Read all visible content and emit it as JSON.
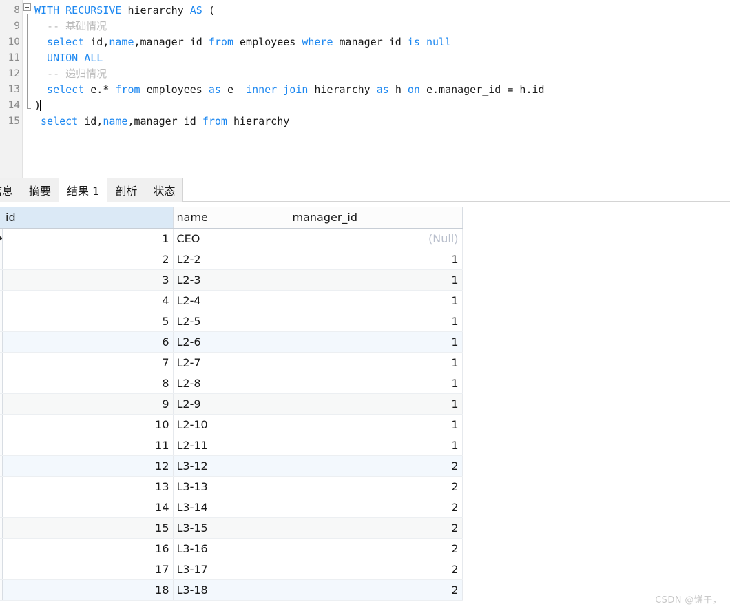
{
  "editor": {
    "first_line_number": 8,
    "fold_marker": "collapse-box",
    "lines": [
      {
        "number": "8",
        "tokens": [
          {
            "t": "WITH RECURSIVE ",
            "c": "kw"
          },
          {
            "t": "hierarchy ",
            "c": "plain"
          },
          {
            "t": "AS ",
            "c": "kw"
          },
          {
            "t": "(",
            "c": "plain"
          }
        ]
      },
      {
        "number": "9",
        "tokens": [
          {
            "t": "  -- 基础情况",
            "c": "cmt"
          }
        ]
      },
      {
        "number": "10",
        "tokens": [
          {
            "t": "  select ",
            "c": "kw"
          },
          {
            "t": "id,",
            "c": "plain"
          },
          {
            "t": "name",
            "c": "kw"
          },
          {
            "t": ",manager_id ",
            "c": "plain"
          },
          {
            "t": "from ",
            "c": "kw"
          },
          {
            "t": "employees ",
            "c": "plain"
          },
          {
            "t": "where ",
            "c": "kw"
          },
          {
            "t": "manager_id ",
            "c": "plain"
          },
          {
            "t": "is null",
            "c": "kw"
          }
        ]
      },
      {
        "number": "11",
        "tokens": [
          {
            "t": "  UNION ALL",
            "c": "kw"
          }
        ]
      },
      {
        "number": "12",
        "tokens": [
          {
            "t": "  -- 递归情况",
            "c": "cmt"
          }
        ]
      },
      {
        "number": "13",
        "tokens": [
          {
            "t": "  select ",
            "c": "kw"
          },
          {
            "t": "e.* ",
            "c": "plain"
          },
          {
            "t": "from ",
            "c": "kw"
          },
          {
            "t": "employees ",
            "c": "plain"
          },
          {
            "t": "as ",
            "c": "kw"
          },
          {
            "t": "e  ",
            "c": "plain"
          },
          {
            "t": "inner join ",
            "c": "kw"
          },
          {
            "t": "hierarchy ",
            "c": "plain"
          },
          {
            "t": "as ",
            "c": "kw"
          },
          {
            "t": "h ",
            "c": "plain"
          },
          {
            "t": "on ",
            "c": "kw"
          },
          {
            "t": "e.manager_id = h.id",
            "c": "plain"
          }
        ]
      },
      {
        "number": "14",
        "tokens": [
          {
            "t": ")",
            "c": "plain"
          }
        ],
        "caret_after": true
      },
      {
        "number": "15",
        "tokens": [
          {
            "t": " select ",
            "c": "kw"
          },
          {
            "t": "id,",
            "c": "plain"
          },
          {
            "t": "name",
            "c": "kw"
          },
          {
            "t": ",manager_id ",
            "c": "plain"
          },
          {
            "t": "from ",
            "c": "kw"
          },
          {
            "t": "hierarchy",
            "c": "plain"
          }
        ]
      }
    ]
  },
  "tabs": [
    {
      "label": "信息",
      "active": false
    },
    {
      "label": "摘要",
      "active": false
    },
    {
      "label": "结果 1",
      "active": true
    },
    {
      "label": "剖析",
      "active": false
    },
    {
      "label": "状态",
      "active": false
    }
  ],
  "result_grid": {
    "columns": [
      "id",
      "name",
      "manager_id"
    ],
    "selected_column": "id",
    "current_row_index": 0,
    "rows": [
      {
        "id": "1",
        "name": "CEO",
        "manager_id": "(Null)",
        "manager_id_null": true,
        "stripe": "white"
      },
      {
        "id": "2",
        "name": "L2-2",
        "manager_id": "1",
        "manager_id_null": false,
        "stripe": "white"
      },
      {
        "id": "3",
        "name": "L2-3",
        "manager_id": "1",
        "manager_id_null": false,
        "stripe": "gray"
      },
      {
        "id": "4",
        "name": "L2-4",
        "manager_id": "1",
        "manager_id_null": false,
        "stripe": "white"
      },
      {
        "id": "5",
        "name": "L2-5",
        "manager_id": "1",
        "manager_id_null": false,
        "stripe": "white"
      },
      {
        "id": "6",
        "name": "L2-6",
        "manager_id": "1",
        "manager_id_null": false,
        "stripe": "blue"
      },
      {
        "id": "7",
        "name": "L2-7",
        "manager_id": "1",
        "manager_id_null": false,
        "stripe": "white"
      },
      {
        "id": "8",
        "name": "L2-8",
        "manager_id": "1",
        "manager_id_null": false,
        "stripe": "white"
      },
      {
        "id": "9",
        "name": "L2-9",
        "manager_id": "1",
        "manager_id_null": false,
        "stripe": "gray"
      },
      {
        "id": "10",
        "name": "L2-10",
        "manager_id": "1",
        "manager_id_null": false,
        "stripe": "white"
      },
      {
        "id": "11",
        "name": "L2-11",
        "manager_id": "1",
        "manager_id_null": false,
        "stripe": "white"
      },
      {
        "id": "12",
        "name": "L3-12",
        "manager_id": "2",
        "manager_id_null": false,
        "stripe": "blue"
      },
      {
        "id": "13",
        "name": "L3-13",
        "manager_id": "2",
        "manager_id_null": false,
        "stripe": "white"
      },
      {
        "id": "14",
        "name": "L3-14",
        "manager_id": "2",
        "manager_id_null": false,
        "stripe": "white"
      },
      {
        "id": "15",
        "name": "L3-15",
        "manager_id": "2",
        "manager_id_null": false,
        "stripe": "gray"
      },
      {
        "id": "16",
        "name": "L3-16",
        "manager_id": "2",
        "manager_id_null": false,
        "stripe": "white"
      },
      {
        "id": "17",
        "name": "L3-17",
        "manager_id": "2",
        "manager_id_null": false,
        "stripe": "white"
      },
      {
        "id": "18",
        "name": "L3-18",
        "manager_id": "2",
        "manager_id_null": false,
        "stripe": "blue"
      }
    ]
  },
  "watermark": {
    "text": "CSDN @饼干，"
  },
  "colors": {
    "keyword": "#1e88f0",
    "plain_text": "#1a1a1a",
    "comment": "#bcbcbc",
    "selected_header": "#dbe9f6",
    "row_blue": "#f3f8fd",
    "row_gray": "#f7f8f8",
    "null_text": "#b9bfcc"
  }
}
